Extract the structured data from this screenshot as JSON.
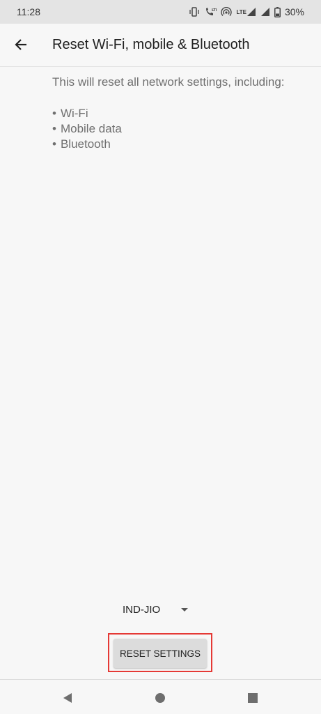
{
  "status_bar": {
    "time": "11:28",
    "lte_label": "LTE",
    "battery": "30%",
    "icons": [
      "vibrate-icon",
      "volte-call-icon",
      "hotspot-icon",
      "lte-signal-icon",
      "signal-icon",
      "battery-icon"
    ]
  },
  "app_bar": {
    "title": "Reset Wi-Fi, mobile & Bluetooth",
    "back_icon": "arrow-back-icon"
  },
  "content": {
    "intro": "This will reset all network settings, including:",
    "items": [
      "Wi-Fi",
      "Mobile data",
      "Bluetooth"
    ]
  },
  "sim_selector": {
    "selected": "IND-JIO"
  },
  "reset_button": {
    "label": "RESET SETTINGS",
    "highlight_color": "#e53935"
  },
  "nav_bar": {
    "icons": [
      "nav-back-icon",
      "nav-home-icon",
      "nav-recents-icon"
    ]
  }
}
